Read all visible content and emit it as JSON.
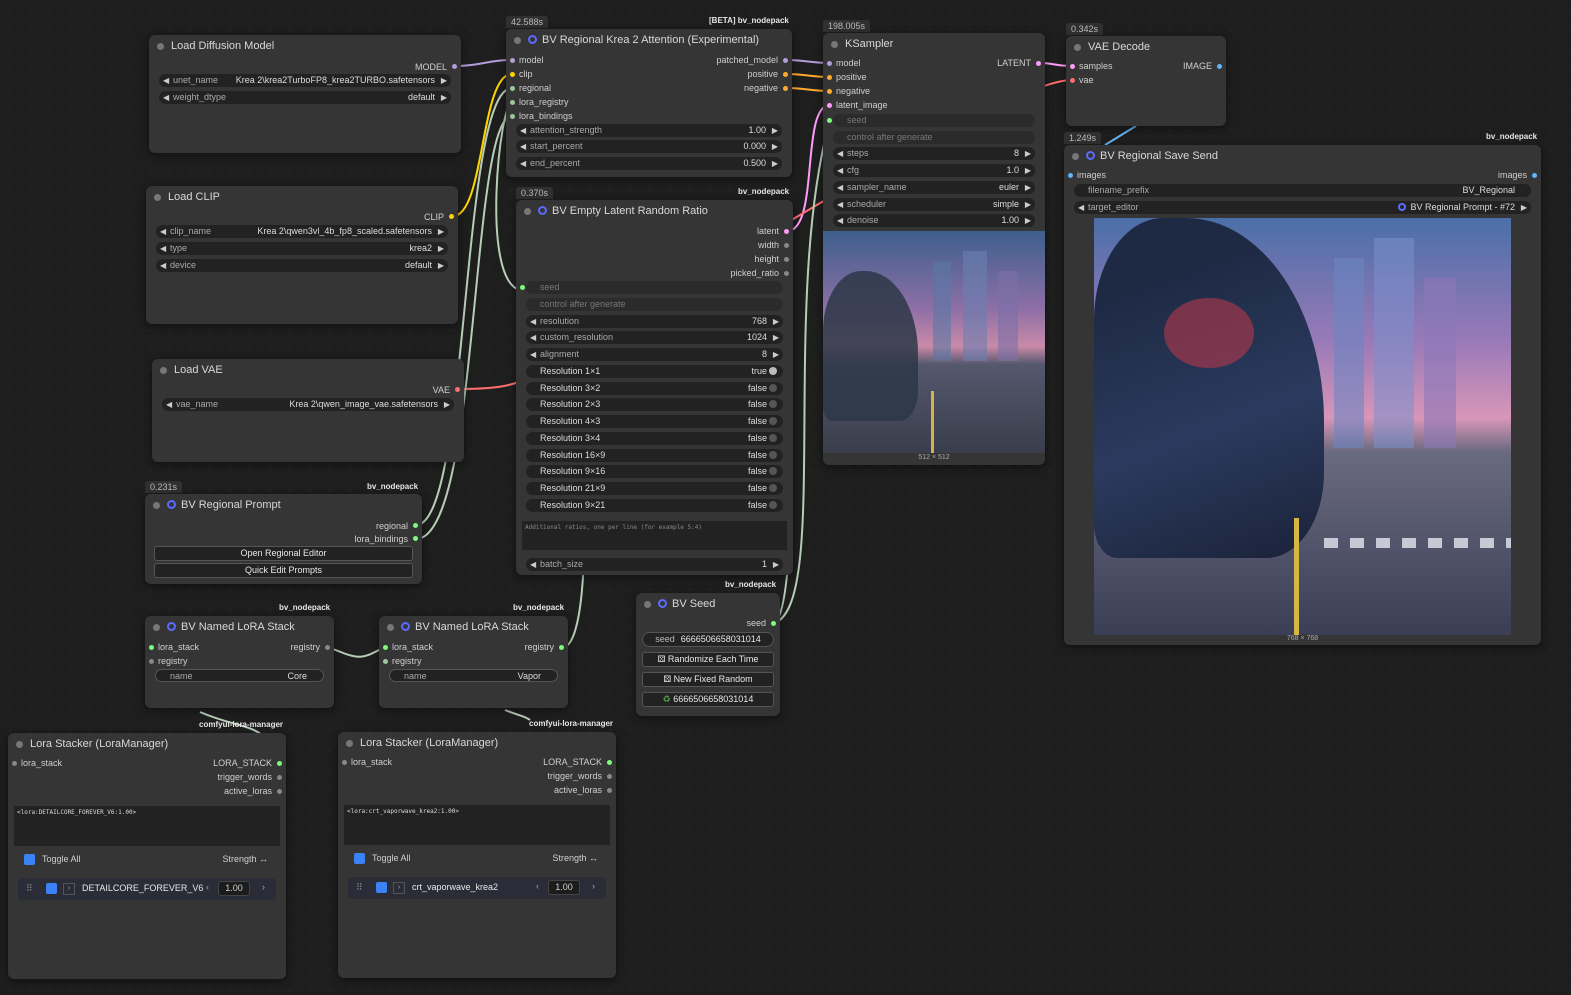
{
  "nodes": {
    "load_diffusion": {
      "title": "Load Diffusion Model",
      "out_model": "MODEL",
      "unet_key": "unet_name",
      "unet_val": "Krea 2\\krea2TurboFP8_krea2TURBO.safetensors",
      "wd_key": "weight_dtype",
      "wd_val": "default"
    },
    "load_clip": {
      "title": "Load CLIP",
      "out": "CLIP",
      "clip_key": "clip_name",
      "clip_val": "Krea 2\\qwen3vl_4b_fp8_scaled.safetensors",
      "type_key": "type",
      "type_val": "krea2",
      "device_key": "device",
      "device_val": "default"
    },
    "load_vae": {
      "title": "Load VAE",
      "out": "VAE",
      "vae_key": "vae_name",
      "vae_val": "Krea 2\\qwen_image_vae.safetensors"
    },
    "regional_prompt": {
      "timing": "0.231s",
      "badge": "bv_nodepack",
      "title": "BV Regional Prompt",
      "out1": "regional",
      "out2": "lora_bindings",
      "btn1": "Open Regional Editor",
      "btn2": "Quick Edit Prompts"
    },
    "attention": {
      "timing": "42.588s",
      "badge": "[BETA] bv_nodepack",
      "title": "BV Regional Krea 2 Attention (Experimental)",
      "in": [
        "model",
        "clip",
        "regional",
        "lora_registry",
        "lora_bindings"
      ],
      "out": [
        "patched_model",
        "positive",
        "negative"
      ],
      "w": [
        {
          "k": "attention_strength",
          "v": "1.00"
        },
        {
          "k": "start_percent",
          "v": "0.000"
        },
        {
          "k": "end_percent",
          "v": "0.500"
        }
      ]
    },
    "empty_latent": {
      "timing": "0.370s",
      "badge": "bv_nodepack",
      "title": "BV Empty Latent Random Ratio",
      "out": [
        "latent",
        "width",
        "height",
        "picked_ratio"
      ],
      "seed": "seed",
      "cag": "control after generate",
      "w": [
        {
          "k": "resolution",
          "v": "768"
        },
        {
          "k": "custom_resolution",
          "v": "1024"
        },
        {
          "k": "alignment",
          "v": "8"
        }
      ],
      "toggles": [
        {
          "k": "Resolution 1×1",
          "v": "true"
        },
        {
          "k": "Resolution 3×2",
          "v": "false"
        },
        {
          "k": "Resolution 2×3",
          "v": "false"
        },
        {
          "k": "Resolution 4×3",
          "v": "false"
        },
        {
          "k": "Resolution 3×4",
          "v": "false"
        },
        {
          "k": "Resolution 16×9",
          "v": "false"
        },
        {
          "k": "Resolution 9×16",
          "v": "false"
        },
        {
          "k": "Resolution 21×9",
          "v": "false"
        },
        {
          "k": "Resolution 9×21",
          "v": "false"
        }
      ],
      "placeholder": "Additional ratios, one per line (for example 5:4)",
      "batch_key": "batch_size",
      "batch_val": "1"
    },
    "ksampler": {
      "timing": "198.005s",
      "title": "KSampler",
      "in": [
        "model",
        "positive",
        "negative",
        "latent_image"
      ],
      "out": "LATENT",
      "seed": "seed",
      "cag": "control after generate",
      "w": [
        {
          "k": "steps",
          "v": "8"
        },
        {
          "k": "cfg",
          "v": "1.0"
        },
        {
          "k": "sampler_name",
          "v": "euler"
        },
        {
          "k": "scheduler",
          "v": "simple"
        },
        {
          "k": "denoise",
          "v": "1.00"
        }
      ],
      "caption": "512 × 512"
    },
    "vae_decode": {
      "timing": "0.342s",
      "title": "VAE Decode",
      "in": [
        "samples",
        "vae"
      ],
      "out": "IMAGE"
    },
    "save_send": {
      "timing": "1.249s",
      "badge": "bv_nodepack",
      "title": "BV Regional Save Send",
      "in": "images",
      "out": "images",
      "fp_key": "filename_prefix",
      "fp_val": "BV_Regional",
      "te_key": "target_editor",
      "te_val": "BV Regional Prompt - #72",
      "caption": "768 × 768"
    },
    "bv_seed": {
      "badge": "bv_nodepack",
      "title": "BV Seed",
      "out": "seed",
      "seed_key": "seed",
      "seed_val": "6666506658031014",
      "btn1": "Randomize Each Time",
      "btn2": "New Fixed Random",
      "btn3": "6666506658031014"
    },
    "lora_stack1": {
      "badge": "bv_nodepack",
      "title": "BV Named LoRA Stack",
      "in1": "lora_stack",
      "in2": "registry",
      "out": "registry",
      "name_key": "name",
      "name_val": "Core"
    },
    "lora_stack2": {
      "badge": "bv_nodepack",
      "title": "BV Named LoRA Stack",
      "in1": "lora_stack",
      "in2": "registry",
      "out": "registry",
      "name_key": "name",
      "name_val": "Vapor"
    },
    "stacker1": {
      "badge": "comfyui-lora-manager",
      "title": "Lora Stacker (LoraManager)",
      "in": "lora_stack",
      "out": [
        "LORA_STACK",
        "trigger_words",
        "active_loras"
      ],
      "text": "<lora:DETAILCORE_FOREVER_V6:1.00>",
      "toggle_all": "Toggle All",
      "strength": "Strength ↔",
      "lora_name": "DETAILCORE_FOREVER_V6",
      "lora_val": "1.00"
    },
    "stacker2": {
      "badge": "comfyui-lora-manager",
      "title": "Lora Stacker (LoraManager)",
      "in": "lora_stack",
      "out": [
        "LORA_STACK",
        "trigger_words",
        "active_loras"
      ],
      "text": "<lora:crt_vaporwave_krea2:1.00>",
      "toggle_all": "Toggle All",
      "strength": "Strength ↔",
      "lora_name": "crt_vaporwave_krea2",
      "lora_val": "1.00"
    }
  },
  "colors": {
    "model": "#b39ddb",
    "clip": "#ffd500",
    "conditioning": "#ffa931",
    "latent": "#ff9cf9",
    "vae": "#ff6e6e",
    "image": "#64b5f6",
    "generic": "#9ec79e",
    "int": "#7cfc7c"
  }
}
